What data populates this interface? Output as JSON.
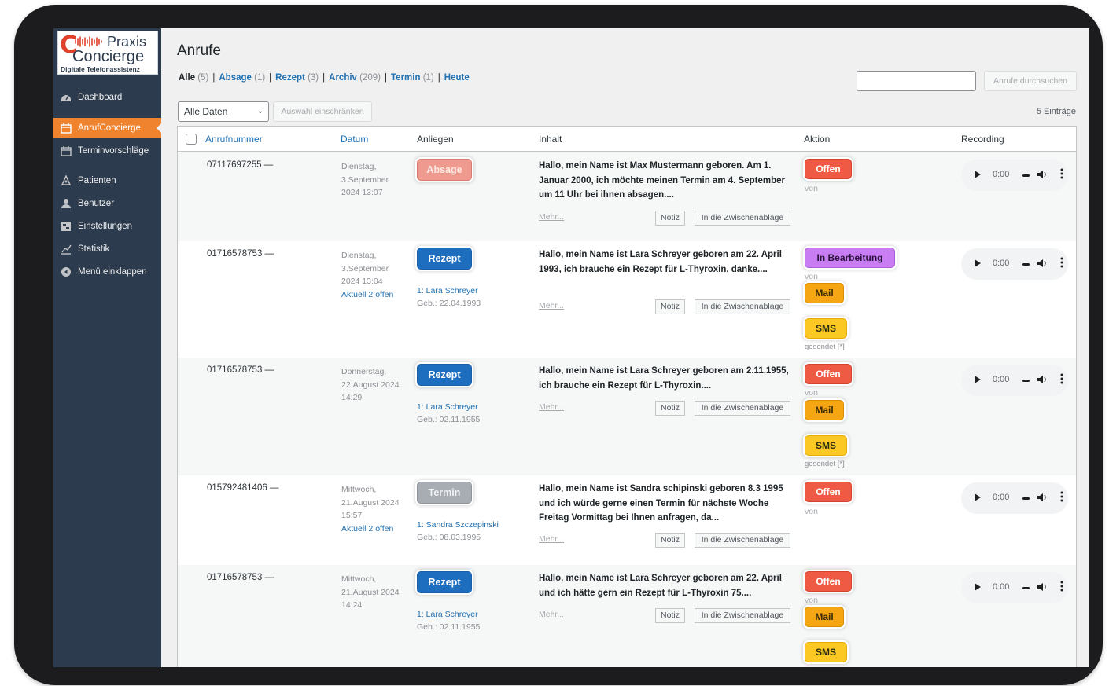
{
  "logo": {
    "line1": "Praxis",
    "line2": "Concierge",
    "tagline": "Digitale Telefonassistenz"
  },
  "sidebar": {
    "items": [
      {
        "label": "Dashboard",
        "icon": "dashboard-icon"
      },
      {
        "label": "AnrufConcierge",
        "icon": "calendar-icon",
        "active": true
      },
      {
        "label": "Terminvorschläge",
        "icon": "calendar-icon"
      },
      {
        "label": "Patienten",
        "icon": "user-group-icon"
      },
      {
        "label": "Benutzer",
        "icon": "user-icon"
      },
      {
        "label": "Einstellungen",
        "icon": "settings-icon"
      },
      {
        "label": "Statistik",
        "icon": "chart-icon"
      },
      {
        "label": "Menü einklappen",
        "icon": "collapse-icon"
      }
    ]
  },
  "header": {
    "title": "Anrufe",
    "filters": [
      {
        "label": "Alle",
        "count": "(5)",
        "current": true
      },
      {
        "label": "Absage",
        "count": "(1)"
      },
      {
        "label": "Rezept",
        "count": "(3)"
      },
      {
        "label": "Archiv",
        "count": "(209)"
      },
      {
        "label": "Termin",
        "count": "(1)"
      },
      {
        "label": "Heute",
        "count": ""
      }
    ],
    "search_value": "",
    "search_button": "Anrufe durchsuchen",
    "date_select": "Alle Daten",
    "filter_button": "Auswahl einschränken",
    "entries_count": "5 Einträge"
  },
  "table": {
    "columns": [
      "Anrufnummer",
      "Datum",
      "Anliegen",
      "Inhalt",
      "Aktion",
      "Recording"
    ],
    "more_label": "Mehr...",
    "notiz_label": "Notiz",
    "clipboard_label": "In die Zwischenablage",
    "von_label": "von",
    "gesendet_label": "gesendet [*]",
    "audio_time": "0:00",
    "rows": [
      {
        "phone": "07117697255 —",
        "date_lines": [
          "Dienstag,",
          "3.September",
          "2024 13:07"
        ],
        "aktuell": "",
        "request": "Absage",
        "patient_name": "",
        "patient_dob": "",
        "content": "Hallo, mein Name ist Max Mustermann geboren. Am 1. Januar 2000, ich möchte meinen Termin am 4. September um 11 Uhr bei ihnen absagen....",
        "status": "Offen"
      },
      {
        "phone": "01716578753 —",
        "date_lines": [
          "Dienstag,",
          "3.September",
          "2024 13:04"
        ],
        "aktuell": "Aktuell 2 offen",
        "request": "Rezept",
        "patient_name": "1: Lara Schreyer",
        "patient_dob": "Geb.: 22.04.1993",
        "content": "Hallo, mein Name ist Lara Schreyer geboren am 22. April 1993, ich brauche ein Rezept für L-Thyroxin, danke....",
        "status": "In Bearbeitung",
        "mail": "Mail",
        "sms": "SMS"
      },
      {
        "phone": "01716578753 —",
        "date_lines": [
          "Donnerstag,",
          "22.August 2024",
          "14:29"
        ],
        "aktuell": "",
        "request": "Rezept",
        "patient_name": "1: Lara Schreyer",
        "patient_dob": "Geb.: 02.11.1955",
        "content": "Hallo, mein Name ist Lara Schreyer geboren am 2.11.1955, ich brauche ein Rezept für L-Thyroxin....",
        "status": "Offen",
        "mail": "Mail",
        "sms": "SMS"
      },
      {
        "phone": "015792481406 —",
        "date_lines": [
          "Mittwoch,",
          "21.August 2024",
          "15:57"
        ],
        "aktuell": "Aktuell 2 offen",
        "request": "Termin",
        "patient_name": "1: Sandra Szczepinski",
        "patient_dob": "Geb.: 08.03.1995",
        "content": "Hallo, mein Name ist Sandra schipinski geboren 8.3 1995 und ich würde gerne einen Termin für nächste Woche Freitag Vormittag bei Ihnen anfragen, da...",
        "status": "Offen"
      },
      {
        "phone": "01716578753 —",
        "date_lines": [
          "Mittwoch,",
          "21.August 2024",
          "14:24"
        ],
        "aktuell": "",
        "request": "Rezept",
        "patient_name": "1: Lara Schreyer",
        "patient_dob": "Geb.: 02.11.1955",
        "content": "Hallo, mein Name ist Lara Schreyer geboren am 22. April und ich hätte gern ein Rezept für L-Thyroxin 75....",
        "status": "Offen",
        "mail": "Mail",
        "sms": "SMS"
      }
    ]
  }
}
